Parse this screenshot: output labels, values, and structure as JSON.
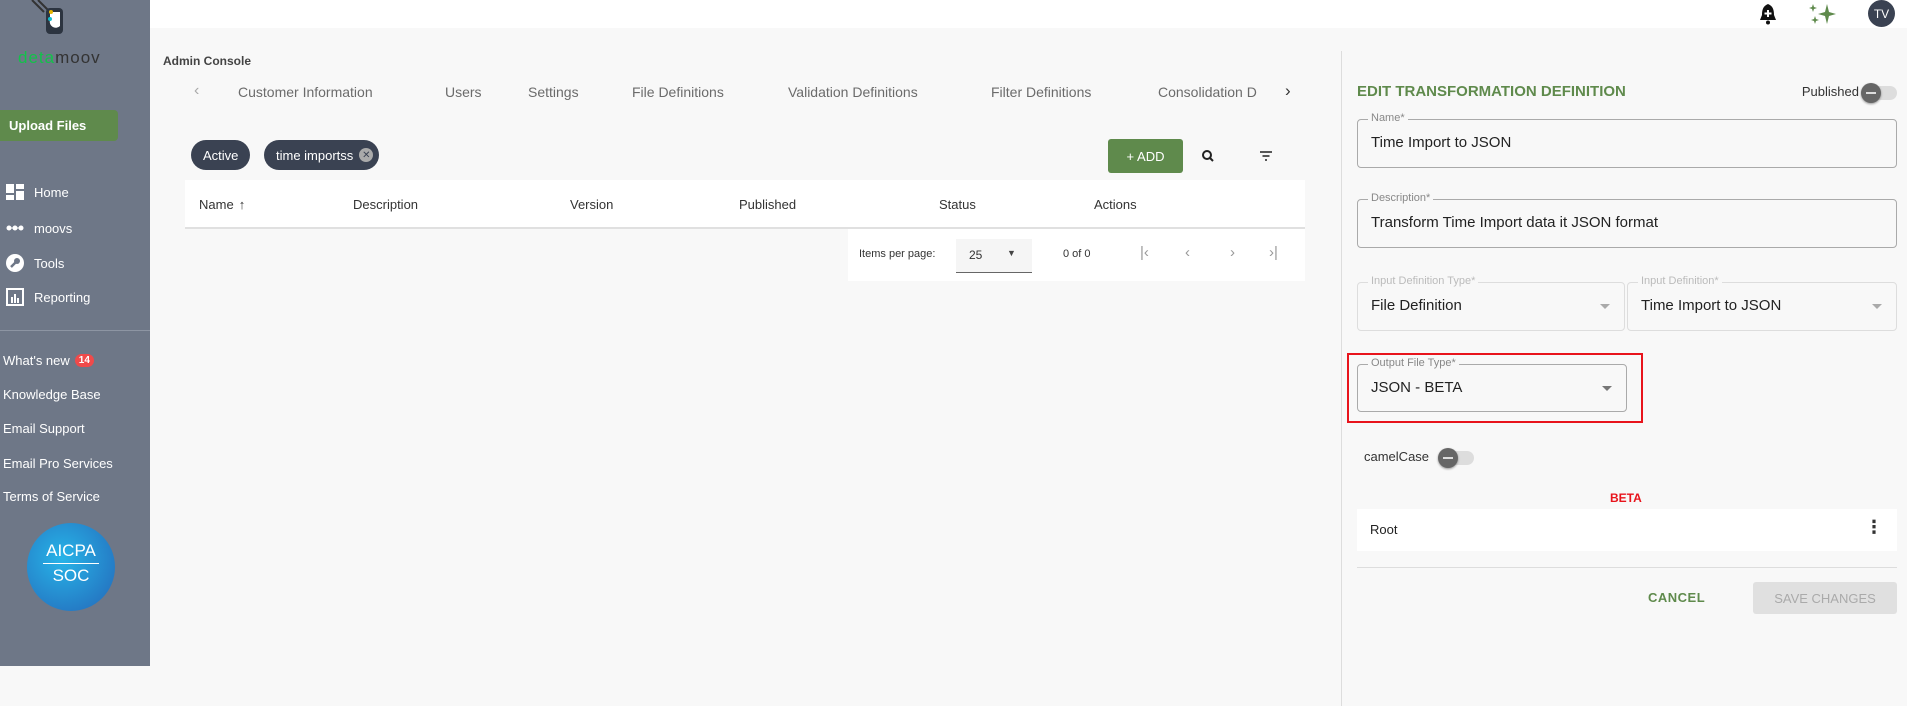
{
  "brand": {
    "logo_text_a": "deta",
    "logo_text_b": "moov",
    "accent": "#5f8a4c"
  },
  "sidebar": {
    "upload_label": "Upload Files",
    "nav": [
      {
        "label": "Home",
        "icon": "dashboard-icon"
      },
      {
        "label": "moovs",
        "icon": "dots-icon"
      },
      {
        "label": "Tools",
        "icon": "wrench-icon"
      },
      {
        "label": "Reporting",
        "icon": "chart-icon"
      }
    ],
    "links": [
      {
        "label": "What's new",
        "badge": "14"
      },
      {
        "label": "Knowledge Base"
      },
      {
        "label": "Email Support"
      },
      {
        "label": "Email Pro Services"
      },
      {
        "label": "Terms of Service"
      }
    ],
    "badge_logo": {
      "line1": "AICPA",
      "line2": "SOC"
    }
  },
  "header": {
    "avatar_initials": "TV"
  },
  "main": {
    "section_title": "Admin Console",
    "tabs": [
      "Customer Information",
      "Users",
      "Settings",
      "File Definitions",
      "Validation Definitions",
      "Filter Definitions",
      "Consolidation D"
    ],
    "chips": [
      "Active",
      "time importss"
    ],
    "add_label": "+ ADD",
    "columns": [
      "Name",
      "Description",
      "Version",
      "Published",
      "Status",
      "Actions"
    ],
    "paginator": {
      "items_label": "Items per page:",
      "page_size": "25",
      "range": "0 of 0"
    }
  },
  "panel": {
    "title": "EDIT TRANSFORMATION DEFINITION",
    "published_label": "Published",
    "name": {
      "label": "Name*",
      "value": "Time Import to JSON"
    },
    "description": {
      "label": "Description*",
      "value": "Transform Time Import data it JSON format"
    },
    "input_type": {
      "label": "Input Definition Type*",
      "value": "File Definition"
    },
    "input_def": {
      "label": "Input Definition*",
      "value": "Time Import to JSON"
    },
    "output_type": {
      "label": "Output File Type*",
      "value": "JSON - BETA"
    },
    "camel_label": "camelCase",
    "beta_label": "BETA",
    "root_label": "Root",
    "cancel_label": "CANCEL",
    "save_label": "SAVE CHANGES"
  }
}
